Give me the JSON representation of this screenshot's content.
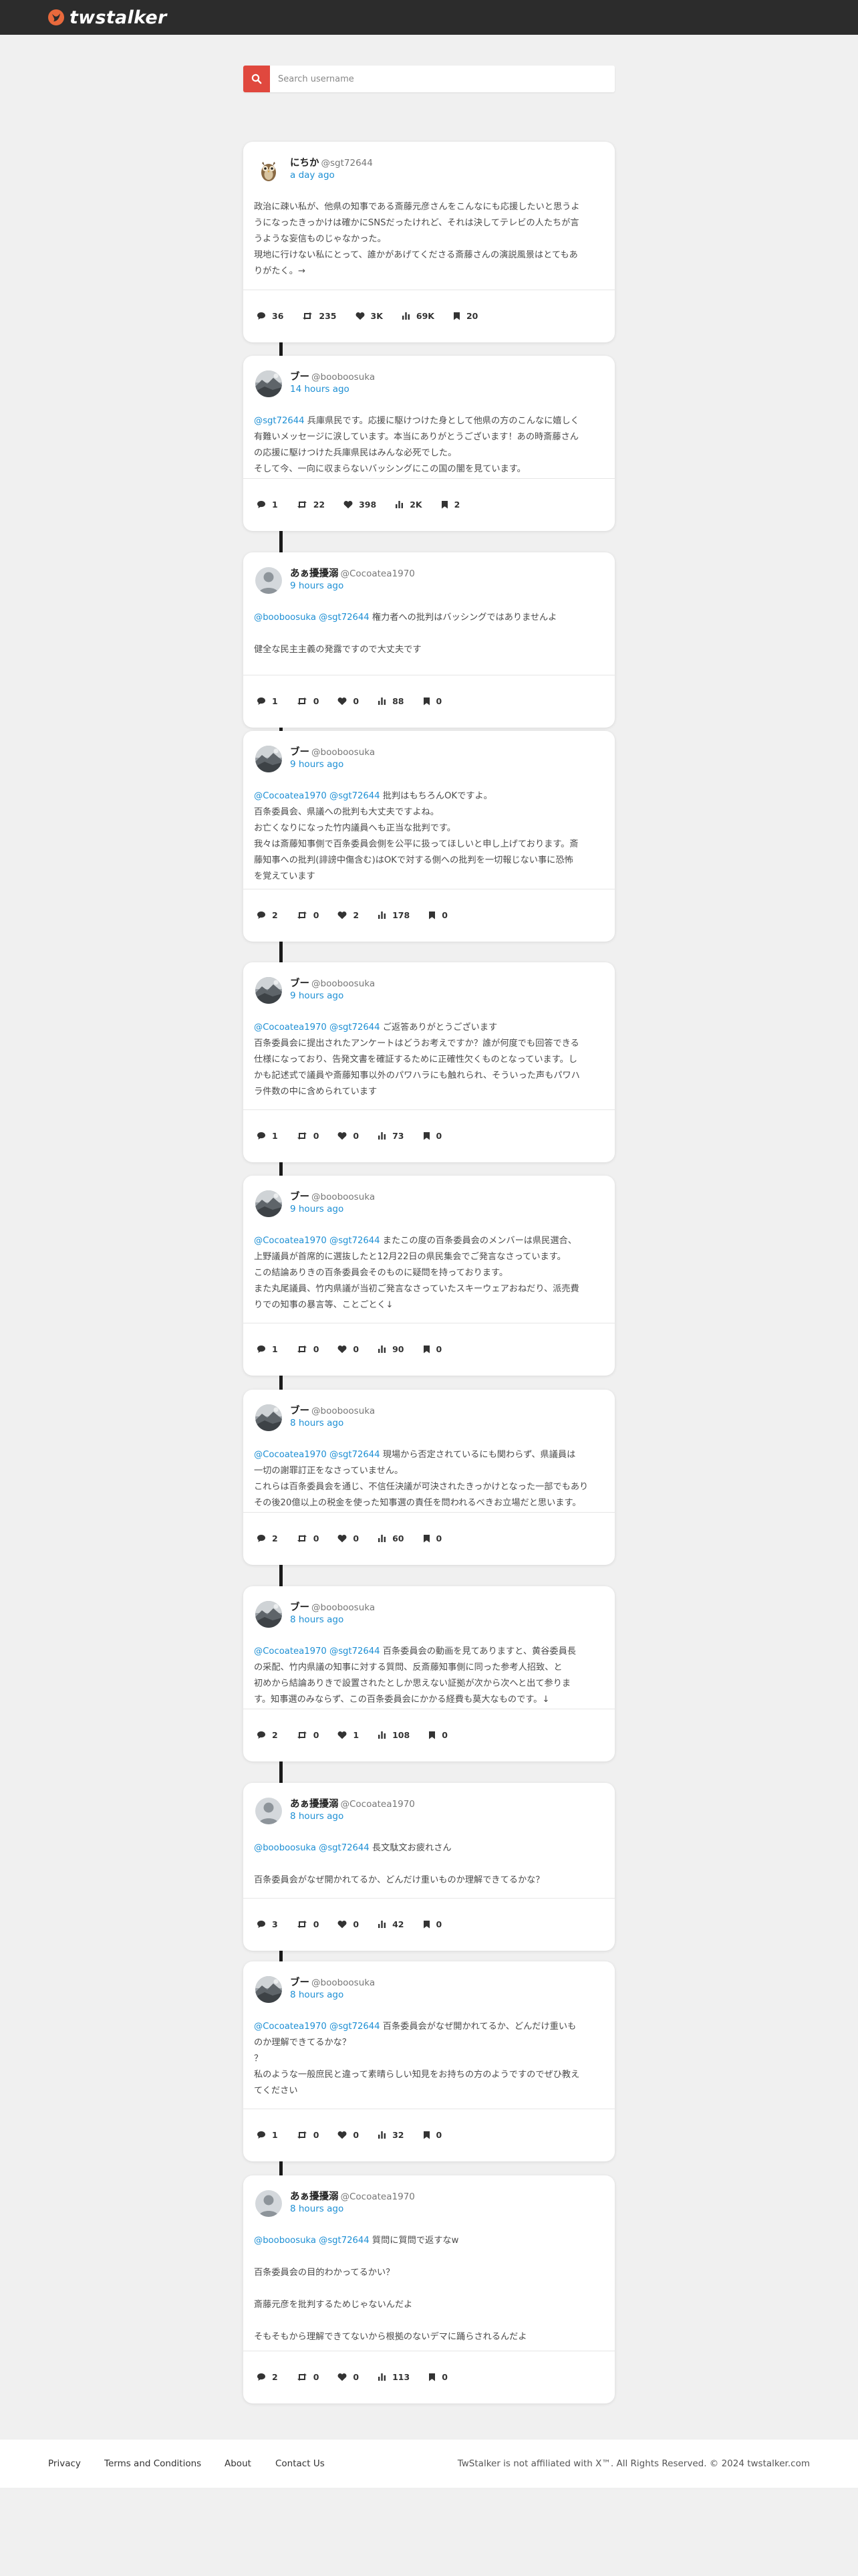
{
  "header": {
    "logo_text": "twstalker"
  },
  "search": {
    "placeholder": "Search username",
    "value": ""
  },
  "footer": {
    "links": [
      "Privacy",
      "Terms and Conditions",
      "About",
      "Contact Us"
    ],
    "notice": "TwStalker is not affiliated with X™. All Rights Reserved. © 2024 twstalker.com"
  },
  "colors": {
    "accent": "#e0483e",
    "mention": "#1d8fd4",
    "topbar": "#2c2c2c"
  },
  "posts": [
    {
      "avatar": "owl-avatar",
      "name": "にちか",
      "handle": "@sgt72644",
      "time": "a day ago",
      "lines": [
        [
          {
            "t": "政治に疎い私が、他県の知事である斎藤元彦さんをこんなにも応援したいと思うよ"
          }
        ],
        [
          {
            "t": "うになったきっかけは確かにSNSだったけれど、それは決してテレビの人たちが言"
          }
        ],
        [
          {
            "t": "うような妄信ものじゃなかった。"
          }
        ],
        [
          {
            "t": "現地に行けない私にとって、誰かがあげてくださる斎藤さんの演説風景はとてもあ"
          }
        ],
        [
          {
            "t": "りがたく。→"
          }
        ]
      ],
      "stats": {
        "comments": "36",
        "retweets": "235",
        "likes": "3K",
        "views": "69K",
        "bookmarks": "20"
      }
    },
    {
      "avatar": "landscape-avatar",
      "name": "ブー",
      "handle": "@booboosuka",
      "time": "14 hours ago",
      "lines": [
        [
          {
            "t": "@sgt72644",
            "m": 1
          },
          {
            "t": " 兵庫県民です。応援に駆けつけた身として他県の方のこんなに嬉しく"
          }
        ],
        [
          {
            "t": "有難いメッセージに涙しています。本当にありがとうございます！あの時斎藤さん"
          }
        ],
        [
          {
            "t": "の応援に駆けつけた兵庫県民はみんな必死でした。"
          }
        ],
        [
          {
            "t": "そして今、一向に収まらないバッシングにこの国の闇を見ています。"
          }
        ]
      ],
      "stats": {
        "comments": "1",
        "retweets": "22",
        "likes": "398",
        "views": "2K",
        "bookmarks": "2"
      }
    },
    {
      "avatar": "default-avatar",
      "name": "あぁ擾擾溺",
      "handle": "@Cocoatea1970",
      "time": "9 hours ago",
      "lines": [
        [
          {
            "t": "@booboosuka",
            "m": 1
          },
          {
            "t": " "
          },
          {
            "t": "@sgt72644",
            "m": 1
          },
          {
            "t": " 権力者への批判はバッシングではありませんよ"
          }
        ],
        [
          {
            "t": ""
          }
        ],
        [
          {
            "t": "健全な民主主義の発露ですので大丈夫です"
          }
        ]
      ],
      "stats": {
        "comments": "1",
        "retweets": "0",
        "likes": "0",
        "views": "88",
        "bookmarks": "0"
      }
    },
    {
      "avatar": "landscape-avatar",
      "name": "ブー",
      "handle": "@booboosuka",
      "time": "9 hours ago",
      "lines": [
        [
          {
            "t": "@Cocoatea1970",
            "m": 1
          },
          {
            "t": " "
          },
          {
            "t": "@sgt72644",
            "m": 1
          },
          {
            "t": " 批判はもちろんOKですよ。"
          }
        ],
        [
          {
            "t": "百条委員会、県議への批判も大丈夫ですよね。"
          }
        ],
        [
          {
            "t": "お亡くなりになった竹内議員へも正当な批判です。"
          }
        ],
        [
          {
            "t": "我々は斎藤知事側で百条委員会側を公平に扱ってほしいと申し上げております。斎"
          }
        ],
        [
          {
            "t": "藤知事への批判(誹謗中傷含む)はOKで対する側への批判を一切報じない事に恐怖"
          }
        ],
        [
          {
            "t": "を覚えています"
          }
        ]
      ],
      "stats": {
        "comments": "2",
        "retweets": "0",
        "likes": "2",
        "views": "178",
        "bookmarks": "0"
      }
    },
    {
      "avatar": "landscape-avatar",
      "name": "ブー",
      "handle": "@booboosuka",
      "time": "9 hours ago",
      "lines": [
        [
          {
            "t": "@Cocoatea1970",
            "m": 1
          },
          {
            "t": " "
          },
          {
            "t": "@sgt72644",
            "m": 1
          },
          {
            "t": " ご返答ありがとうございます"
          }
        ],
        [
          {
            "t": "百条委員会に提出されたアンケートはどうお考えですか？誰が何度でも回答できる"
          }
        ],
        [
          {
            "t": "仕様になっており、告発文書を確証するために正確性欠くものとなっています。し"
          }
        ],
        [
          {
            "t": "かも記述式で議員や斎藤知事以外のパワハラにも触れられ、そういった声もパワハ"
          }
        ],
        [
          {
            "t": "ラ件数の中に含められています"
          }
        ]
      ],
      "stats": {
        "comments": "1",
        "retweets": "0",
        "likes": "0",
        "views": "73",
        "bookmarks": "0"
      }
    },
    {
      "avatar": "landscape-avatar",
      "name": "ブー",
      "handle": "@booboosuka",
      "time": "9 hours ago",
      "lines": [
        [
          {
            "t": "@Cocoatea1970",
            "m": 1
          },
          {
            "t": " "
          },
          {
            "t": "@sgt72644",
            "m": 1
          },
          {
            "t": " またこの度の百条委員会のメンバーは県民選合、"
          }
        ],
        [
          {
            "t": "上野議員が首席的に選抜したと12月22日の県民集会でご発言なさっています。"
          }
        ],
        [
          {
            "t": "この結論ありきの百条委員会そのものに疑問を持っております。"
          }
        ],
        [
          {
            "t": "また丸尾議員、竹内県議が当初ご発言なさっていたスキーウェアおねだり、派売費"
          }
        ],
        [
          {
            "t": "りでの知事の暴言等、ことごとく↓"
          }
        ]
      ],
      "stats": {
        "comments": "1",
        "retweets": "0",
        "likes": "0",
        "views": "90",
        "bookmarks": "0"
      }
    },
    {
      "avatar": "landscape-avatar",
      "name": "ブー",
      "handle": "@booboosuka",
      "time": "8 hours ago",
      "lines": [
        [
          {
            "t": "@Cocoatea1970",
            "m": 1
          },
          {
            "t": " "
          },
          {
            "t": "@sgt72644",
            "m": 1
          },
          {
            "t": " 現場から否定されているにも関わらず、県議員は"
          }
        ],
        [
          {
            "t": "一切の謝罪訂正をなさっていません。"
          }
        ],
        [
          {
            "t": "これらは百条委員会を通じ、不信任決議が可決されたきっかけとなった一部でもあり"
          }
        ],
        [
          {
            "t": "その後20億以上の税金を使った知事選の責任を問われるべきお立場だと思います。"
          }
        ]
      ],
      "stats": {
        "comments": "2",
        "retweets": "0",
        "likes": "0",
        "views": "60",
        "bookmarks": "0"
      }
    },
    {
      "avatar": "landscape-avatar",
      "name": "ブー",
      "handle": "@booboosuka",
      "time": "8 hours ago",
      "lines": [
        [
          {
            "t": "@Cocoatea1970",
            "m": 1
          },
          {
            "t": " "
          },
          {
            "t": "@sgt72644",
            "m": 1
          },
          {
            "t": " 百条委員会の動画を見てありますと、黄谷委員長"
          }
        ],
        [
          {
            "t": "の采配、竹内県議の知事に対する質問、反斎藤知事側に同った参考人招致、と"
          }
        ],
        [
          {
            "t": "初めから結論ありきで設置されたとしか思えない証拠が次から次へと出て参りま"
          }
        ],
        [
          {
            "t": "す。知事選のみならず、この百条委員会にかかる経費も莫大なものです。↓"
          }
        ]
      ],
      "stats": {
        "comments": "2",
        "retweets": "0",
        "likes": "1",
        "views": "108",
        "bookmarks": "0"
      }
    },
    {
      "avatar": "default-avatar",
      "name": "あぁ擾擾溺",
      "handle": "@Cocoatea1970",
      "time": "8 hours ago",
      "lines": [
        [
          {
            "t": "@booboosuka",
            "m": 1
          },
          {
            "t": " "
          },
          {
            "t": "@sgt72644",
            "m": 1
          },
          {
            "t": " 長文駄文お疲れさん"
          }
        ],
        [
          {
            "t": ""
          }
        ],
        [
          {
            "t": "百条委員会がなぜ開かれてるか、どんだけ重いものか理解できてるかな？"
          }
        ]
      ],
      "stats": {
        "comments": "3",
        "retweets": "0",
        "likes": "0",
        "views": "42",
        "bookmarks": "0"
      }
    },
    {
      "avatar": "landscape-avatar",
      "name": "ブー",
      "handle": "@booboosuka",
      "time": "8 hours ago",
      "lines": [
        [
          {
            "t": "@Cocoatea1970",
            "m": 1
          },
          {
            "t": " "
          },
          {
            "t": "@sgt72644",
            "m": 1
          },
          {
            "t": " 百条委員会がなぜ開かれてるか、どんだけ重いも"
          }
        ],
        [
          {
            "t": "のか理解できてるかな？"
          }
        ],
        [
          {
            "t": "？"
          }
        ],
        [
          {
            "t": "私のような一般庶民と違って素晴らしい知見をお持ちの方のようですのでぜひ教え"
          }
        ],
        [
          {
            "t": "てください"
          }
        ]
      ],
      "stats": {
        "comments": "1",
        "retweets": "0",
        "likes": "0",
        "views": "32",
        "bookmarks": "0"
      }
    },
    {
      "avatar": "default-avatar",
      "name": "あぁ擾擾溺",
      "handle": "@Cocoatea1970",
      "time": "8 hours ago",
      "lines": [
        [
          {
            "t": "@booboosuka",
            "m": 1
          },
          {
            "t": " "
          },
          {
            "t": "@sgt72644",
            "m": 1
          },
          {
            "t": " 質問に質問で返すなw"
          }
        ],
        [
          {
            "t": ""
          }
        ],
        [
          {
            "t": "百条委員会の目的わかってるかい？"
          }
        ],
        [
          {
            "t": ""
          }
        ],
        [
          {
            "t": "斎藤元彦を批判するためじゃないんだよ"
          }
        ],
        [
          {
            "t": ""
          }
        ],
        [
          {
            "t": "そもそもから理解できてないから根拠のないデマに踊らされるんだよ"
          }
        ]
      ],
      "stats": {
        "comments": "2",
        "retweets": "0",
        "likes": "0",
        "views": "113",
        "bookmarks": "0"
      }
    }
  ]
}
